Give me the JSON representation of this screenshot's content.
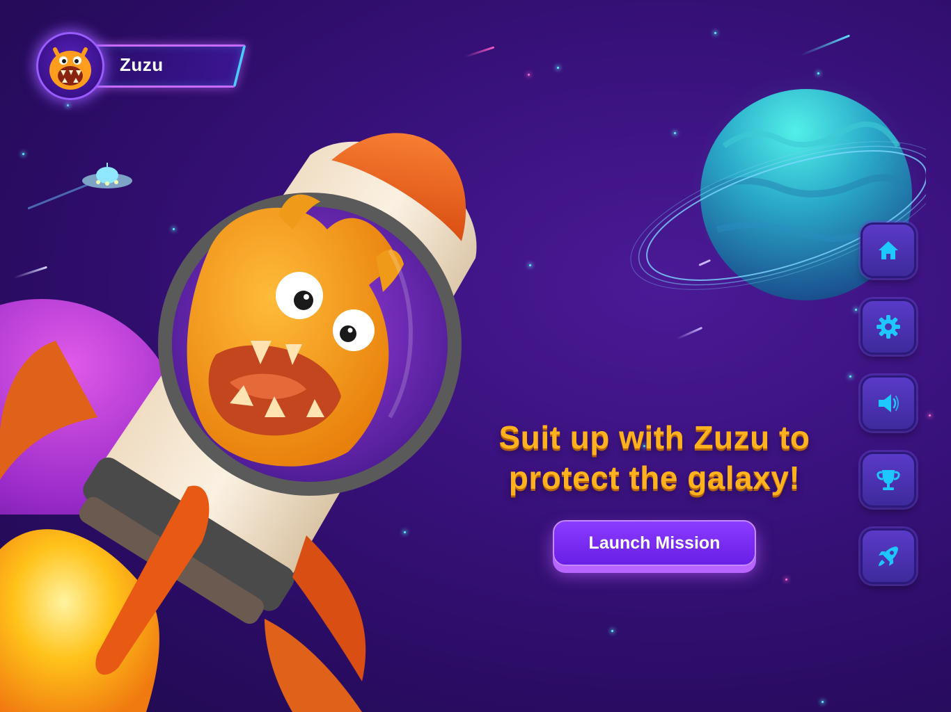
{
  "profile": {
    "name": "Zuzu",
    "avatar_icon": "zuzu-monster-avatar"
  },
  "hero": {
    "headline_line1": "Suit up with Zuzu to",
    "headline_line2": "protect the galaxy!",
    "cta_label": "Launch Mission"
  },
  "side_nav": [
    {
      "id": "home",
      "icon": "home-icon"
    },
    {
      "id": "settings",
      "icon": "gear-icon"
    },
    {
      "id": "sound",
      "icon": "speaker-icon"
    },
    {
      "id": "trophy",
      "icon": "trophy-icon"
    },
    {
      "id": "missions",
      "icon": "rocket-icon"
    }
  ],
  "colors": {
    "background": "#3a127e",
    "headline": "#ffb21e",
    "cta": "#7a2df5",
    "nav_icon": "#1fc7ff",
    "nav_button": "#4a32b0"
  }
}
